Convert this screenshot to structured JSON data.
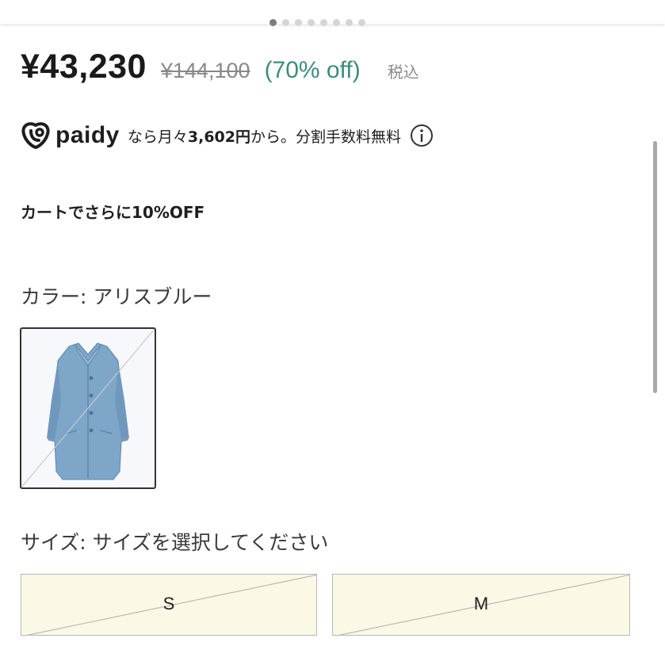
{
  "carousel": {
    "dot_count": 8,
    "active_index": 0
  },
  "product": {
    "price": "¥43,230",
    "original_price": "¥144,100",
    "discount": "(70% off)",
    "tax_note": "税込"
  },
  "paidy": {
    "brand": "paidy",
    "prefix": "なら月々",
    "monthly_amount": "3,602円",
    "suffix": "から。分割手数料無料",
    "info_icon": "info-circle-icon"
  },
  "cart_note": "カートでさらに10%OFF",
  "color": {
    "label": "カラー: アリスブルー",
    "swatch_alt": "blue-coat-swatch"
  },
  "size": {
    "label": "サイズ: サイズを選択してください",
    "options": [
      "S",
      "M"
    ]
  },
  "colors": {
    "discount": "#3d8c7e",
    "size_button_bg": "#fbf8e6"
  }
}
